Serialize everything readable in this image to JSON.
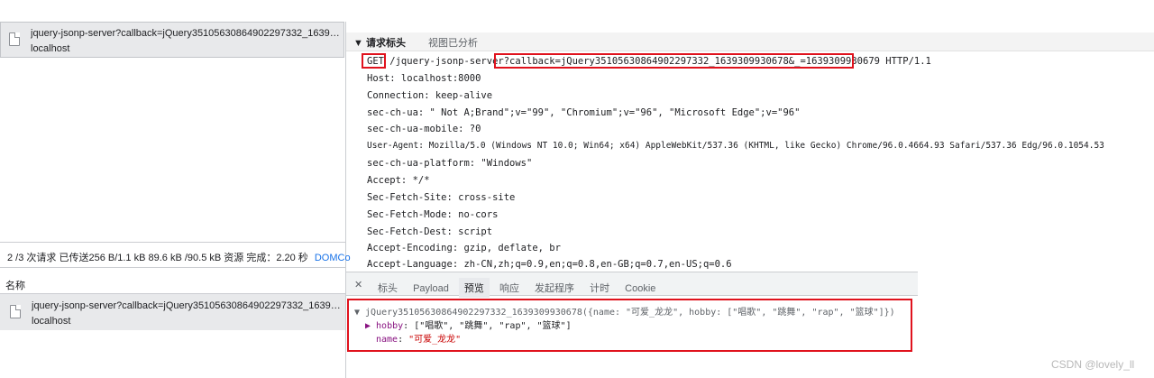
{
  "top_request": {
    "name": "jquery-jsonp-server?callback=jQuery35105630864902297332_163930...",
    "host": "localhost"
  },
  "status_bar": {
    "text": "2 /3 次请求  已传送256 B/1.1 kB  89.6 kB /90.5 kB 资源  完成：2.20 秒",
    "link": "DOMCo"
  },
  "request_list": {
    "header": "名称",
    "item_name": "jquery-jsonp-server?callback=jQuery35105630864902297332_163930...",
    "item_host": "localhost"
  },
  "headers_panel": {
    "section_title": "▼ 请求标头",
    "view_source": "视图已分析",
    "request_line": {
      "method": "GET",
      "path": " /jquery-jsonp-server",
      "query": "?callback=jQuery35105630864902297332_1639309930678&_=1639309930679",
      "protocol": " HTTP/1.1"
    },
    "lines": [
      "Host: localhost:8000",
      "Connection: keep-alive",
      "sec-ch-ua: \" Not A;Brand\";v=\"99\", \"Chromium\";v=\"96\", \"Microsoft Edge\";v=\"96\"",
      "sec-ch-ua-mobile: ?0",
      "User-Agent: Mozilla/5.0 (Windows NT 10.0; Win64; x64) AppleWebKit/537.36 (KHTML, like Gecko) Chrome/96.0.4664.93 Safari/537.36 Edg/96.0.1054.53",
      "sec-ch-ua-platform: \"Windows\"",
      "Accept: */*",
      "Sec-Fetch-Site: cross-site",
      "Sec-Fetch-Mode: no-cors",
      "Sec-Fetch-Dest: script",
      "Accept-Encoding: gzip, deflate, br",
      "Accept-Language: zh-CN,zh;q=0.9,en;q=0.8,en-GB;q=0.7,en-US;q=0.6"
    ]
  },
  "detail_tabs": {
    "close": "✕",
    "tabs": [
      "标头",
      "Payload",
      "预览",
      "响应",
      "发起程序",
      "计时",
      "Cookie"
    ],
    "active": "预览"
  },
  "preview": {
    "root_line": "▼ jQuery35105630864902297332_1639309930678({name: \"可爱_龙龙\", hobby: [\"唱歌\", \"跳舞\", \"rap\", \"篮球\"]})",
    "hobby_key": "▶ hobby",
    "hobby_value": "[\"唱歌\", \"跳舞\", \"rap\", \"篮球\"]",
    "name_key": "name",
    "name_value": "\"可爱_龙龙\""
  },
  "watermark": "CSDN @lovely_ll",
  "colors": {
    "highlight_red": "#e0121d",
    "selected_row": "#e8e9eb",
    "key_purple": "#881280",
    "string_red": "#c80000"
  }
}
